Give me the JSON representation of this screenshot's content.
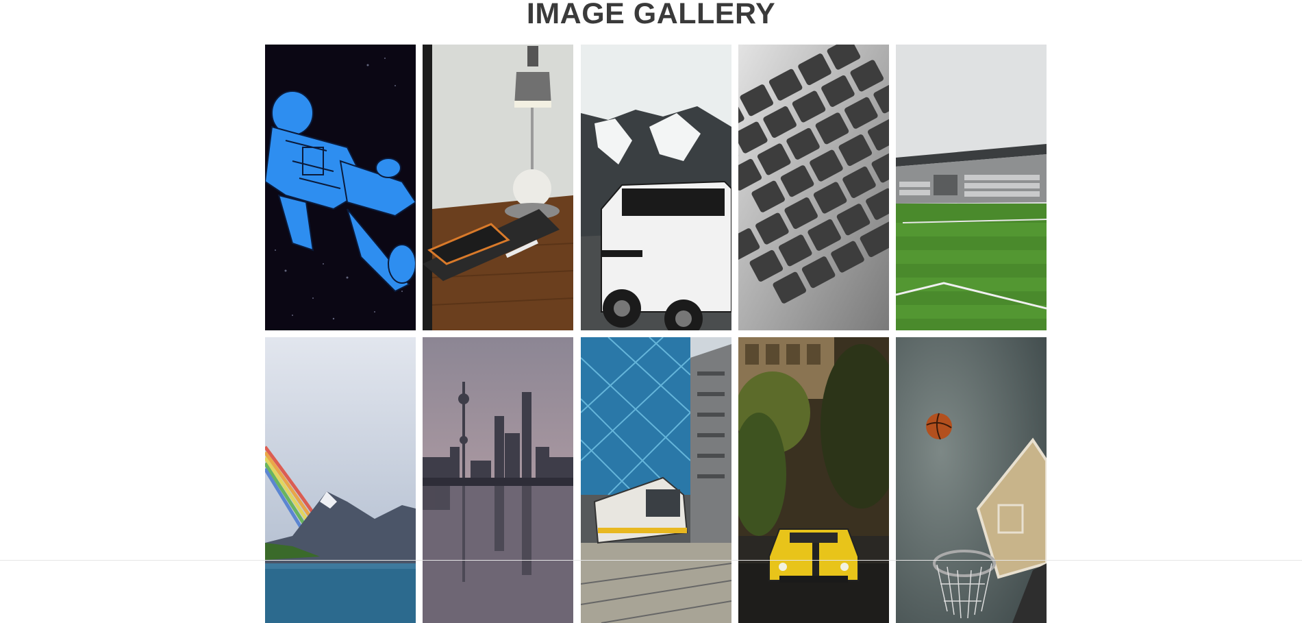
{
  "page": {
    "title": "IMAGE GALLERY"
  },
  "gallery": {
    "items": [
      {
        "subject": "astronaut-illustration"
      },
      {
        "subject": "desk-lamp-phone"
      },
      {
        "subject": "jeep-mountains"
      },
      {
        "subject": "laptop-keyboard"
      },
      {
        "subject": "football-stadium"
      },
      {
        "subject": "rainbow-lake"
      },
      {
        "subject": "city-skyline-reflection"
      },
      {
        "subject": "tram-glass-tower"
      },
      {
        "subject": "yellow-car-street"
      },
      {
        "subject": "basketball-hoop"
      }
    ]
  },
  "colors": {
    "title": "#3a3a3a",
    "background": "#ffffff"
  }
}
